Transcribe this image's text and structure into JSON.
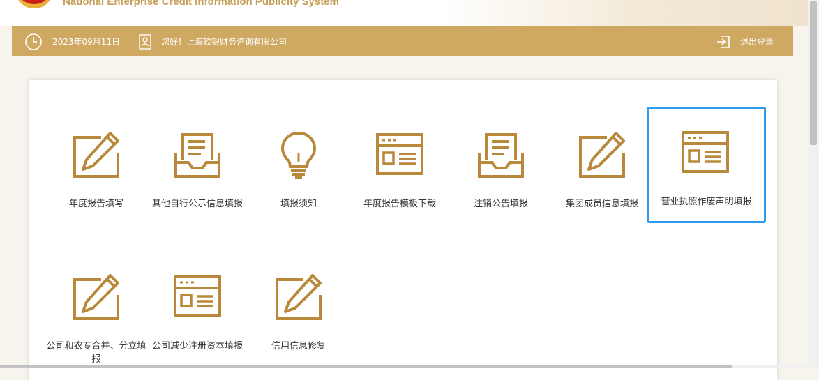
{
  "header": {
    "site_title": "National Enterprise Credit Information Publicity System"
  },
  "info_bar": {
    "date": "2023年09月11日",
    "greeting": "您好！上海软银财务咨询有限公司",
    "logout": "退出登录"
  },
  "tiles": [
    {
      "label": "年度报告填写",
      "icon": "pencil-edit-icon"
    },
    {
      "label": "其他自行公示信息填报",
      "icon": "inbox-document-icon"
    },
    {
      "label": "填报须知",
      "icon": "lightbulb-icon"
    },
    {
      "label": "年度报告模板下载",
      "icon": "browser-window-icon"
    },
    {
      "label": "注销公告填报",
      "icon": "inbox-document-icon"
    },
    {
      "label": "集团成员信息填报",
      "icon": "pencil-edit-icon"
    },
    {
      "label": "营业执照作废声明填报",
      "icon": "browser-window-icon"
    },
    {
      "label": "公司和农专合并、分立填报",
      "icon": "pencil-edit-icon"
    },
    {
      "label": "公司减少注册资本填报",
      "icon": "browser-window-icon"
    },
    {
      "label": "信用信息修复",
      "icon": "pencil-edit-icon"
    }
  ],
  "colors": {
    "accent": "#cfa862",
    "icon": "#b8893a",
    "selection": "#2d9bf0"
  }
}
